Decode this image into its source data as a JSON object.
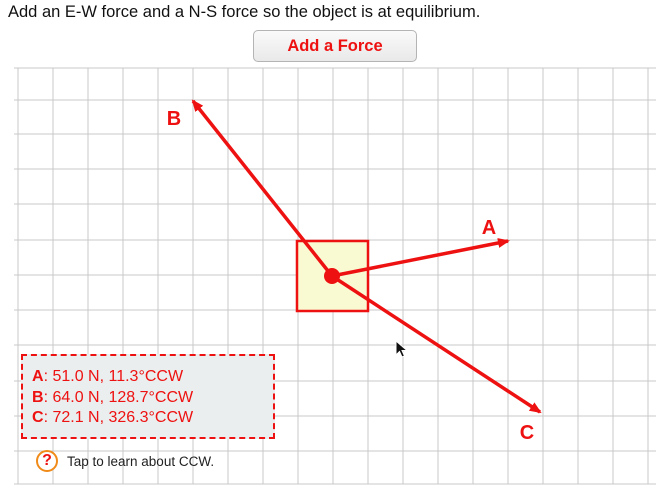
{
  "instruction": "Add an E-W force and a N-S force so the object is at equilibrium.",
  "add_force_label": "Add a Force",
  "colors": {
    "accent": "#ee1111",
    "object_fill": "#fafad2",
    "grid": "#c8c8c8",
    "legend_bg": "#eaeeee",
    "help_ring": "#f08a18"
  },
  "forces": [
    {
      "key": "A",
      "magnitude": "51.0 N",
      "angle": "11.3°CCW",
      "label": "A: 51.0 N, 11.3°CCW"
    },
    {
      "key": "B",
      "magnitude": "64.0 N",
      "angle": "128.7°CCW",
      "label": "B: 64.0 N, 128.7°CCW"
    },
    {
      "key": "C",
      "magnitude": "72.1 N",
      "angle": "326.3°CCW",
      "label": "C: 72.1 N, 326.3°CCW"
    }
  ],
  "help": {
    "icon": "question-icon",
    "icon_glyph": "?",
    "text": "Tap to learn about CCW."
  }
}
